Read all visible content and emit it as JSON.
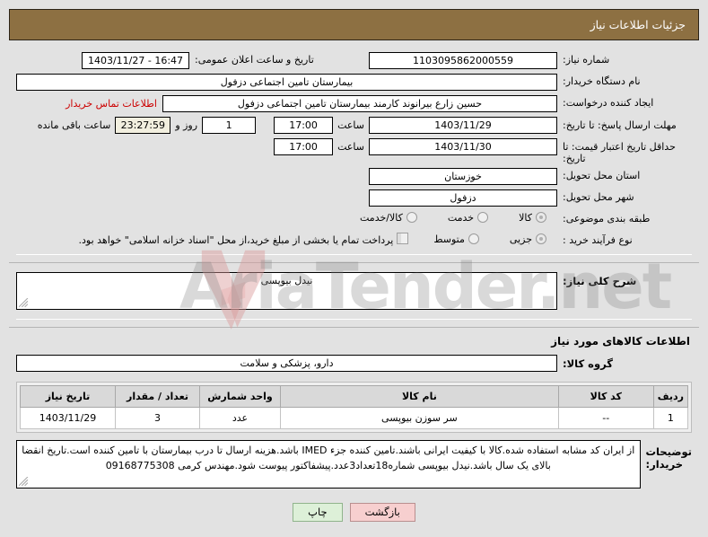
{
  "header": {
    "title": "جزئیات اطلاعات نیاز"
  },
  "form": {
    "need_number_label": "شماره نیاز:",
    "need_number_value": "1103095862000559",
    "announce_datetime_label": "تاریخ و ساعت اعلان عمومی:",
    "announce_datetime_value": "16:47 - 1403/11/27",
    "buyer_org_label": "نام دستگاه خریدار:",
    "buyer_org_value": "بیمارستان تامین اجتماعی دزفول",
    "request_creator_label": "ایجاد کننده درخواست:",
    "request_creator_value": "حسین زارع بیرانوند کارمند بیمارستان تامین اجتماعی دزفول",
    "buyer_contact_link": "اطلاعات تماس خریدار",
    "response_deadline_label": "مهلت ارسال پاسخ: تا تاریخ:",
    "response_deadline_date": "1403/11/29",
    "response_deadline_hour_label": "ساعت",
    "response_deadline_hour": "17:00",
    "remaining_days": "1",
    "remaining_days_label": "روز و",
    "remaining_time": "23:27:59",
    "remaining_time_label": "ساعت باقی مانده",
    "price_validity_label": "حداقل تاریخ اعتبار قیمت: تا تاریخ:",
    "price_validity_date": "1403/11/30",
    "price_validity_hour_label": "ساعت",
    "price_validity_hour": "17:00",
    "delivery_province_label": "استان محل تحویل:",
    "delivery_province_value": "خوزستان",
    "delivery_city_label": "شهر محل تحویل:",
    "delivery_city_value": "دزفول",
    "subject_classification_label": "طبقه بندی موضوعی:",
    "subject_options": [
      {
        "label": "کالا",
        "selected": true
      },
      {
        "label": "خدمت",
        "selected": false
      },
      {
        "label": "کالا/خدمت",
        "selected": false
      }
    ],
    "purchase_process_label": "نوع فرآیند خرید :",
    "purchase_options": [
      {
        "label": "جزیی",
        "selected": true
      },
      {
        "label": "متوسط",
        "selected": false
      }
    ],
    "treasury_checkbox_text": "پرداخت تمام یا بخشی از مبلغ خرید،از محل \"اسناد خزانه اسلامی\" خواهد بود.",
    "treasury_checked": false,
    "need_summary_label": "شرح کلی نیاز:",
    "need_summary_value": "نیدل بیوپسی",
    "goods_section_heading": "اطلاعات کالاهای مورد نیاز",
    "goods_group_label": "گروه کالا:",
    "goods_group_value": "دارو، پزشکی و سلامت"
  },
  "goods_table": {
    "columns": [
      "ردیف",
      "کد کالا",
      "نام کالا",
      "واحد شمارش",
      "تعداد / مقدار",
      "تاریخ نیاز"
    ],
    "rows": [
      {
        "row_no": "1",
        "code": "--",
        "name": "سر سوزن بیوپسی",
        "unit": "عدد",
        "quantity": "3",
        "need_date": "1403/11/29"
      }
    ]
  },
  "notes": {
    "label": "توضیحات خریدار:",
    "text": "از ایران کد مشابه استفاده شده.کالا با کیفیت ایرانی باشند.تامین کننده جزء IMED باشد.هزینه ارسال تا درب بیمارستان با تامین کننده است.تاریخ انقضا بالای یک سال باشد.نیدل بیوپسی شماره18تعداد3عدد.پیشفاکتور پیوست شود.مهندس کرمی 09168775308"
  },
  "footer": {
    "back_button": "بازگشت",
    "print_button": "چاپ"
  },
  "watermark": {
    "text": "AriaTender.net"
  },
  "colors": {
    "header_bg": "#8d7042",
    "page_bg": "#e2e2e2",
    "link_red": "#cc0000",
    "back_btn": "#f7cfcf",
    "print_btn": "#ddf0d8"
  }
}
